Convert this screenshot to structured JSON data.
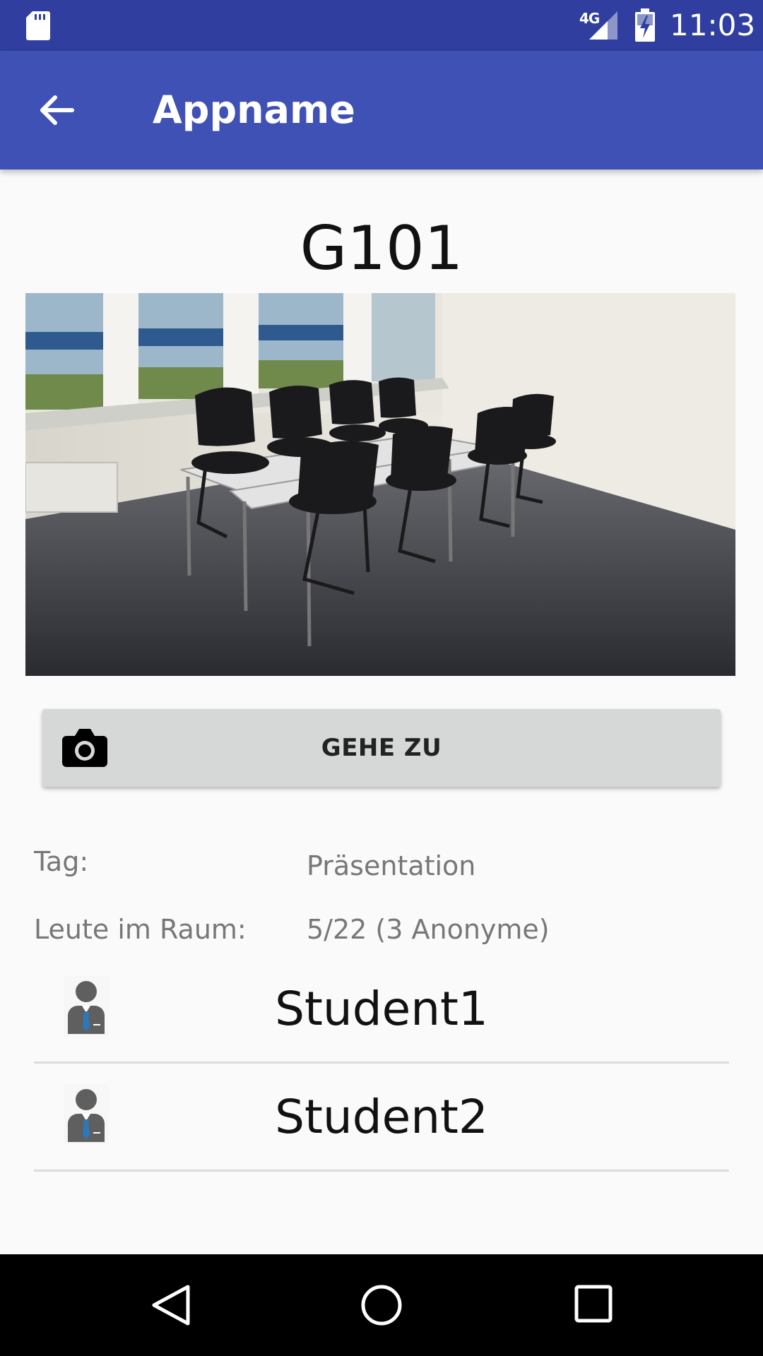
{
  "status_bar": {
    "network": "4G",
    "time": "11:03",
    "icons": [
      "sd-card-icon",
      "signal-icon",
      "battery-charging-icon"
    ]
  },
  "app_bar": {
    "title": "Appname",
    "back_icon": "arrow-back-icon"
  },
  "room": {
    "name": "G101",
    "photo_icon": "classroom-photo"
  },
  "action": {
    "goto_label": "GEHE ZU",
    "icon": "camera-icon"
  },
  "info": {
    "tag_label": "Tag:",
    "tag_value": "Präsentation",
    "people_label": "Leute im Raum:",
    "people_value": "5/22 (3 Anonyme)"
  },
  "students": [
    {
      "name": "Student1",
      "icon": "person-avatar-icon"
    },
    {
      "name": "Student2",
      "icon": "person-avatar-icon"
    }
  ],
  "nav_bar": {
    "icons": [
      "nav-back-icon",
      "nav-home-icon",
      "nav-recents-icon"
    ]
  },
  "colors": {
    "status_bar": "#303F9F",
    "app_bar": "#3F51B5",
    "button": "#D6D7D7",
    "background": "#FAFAFA"
  }
}
